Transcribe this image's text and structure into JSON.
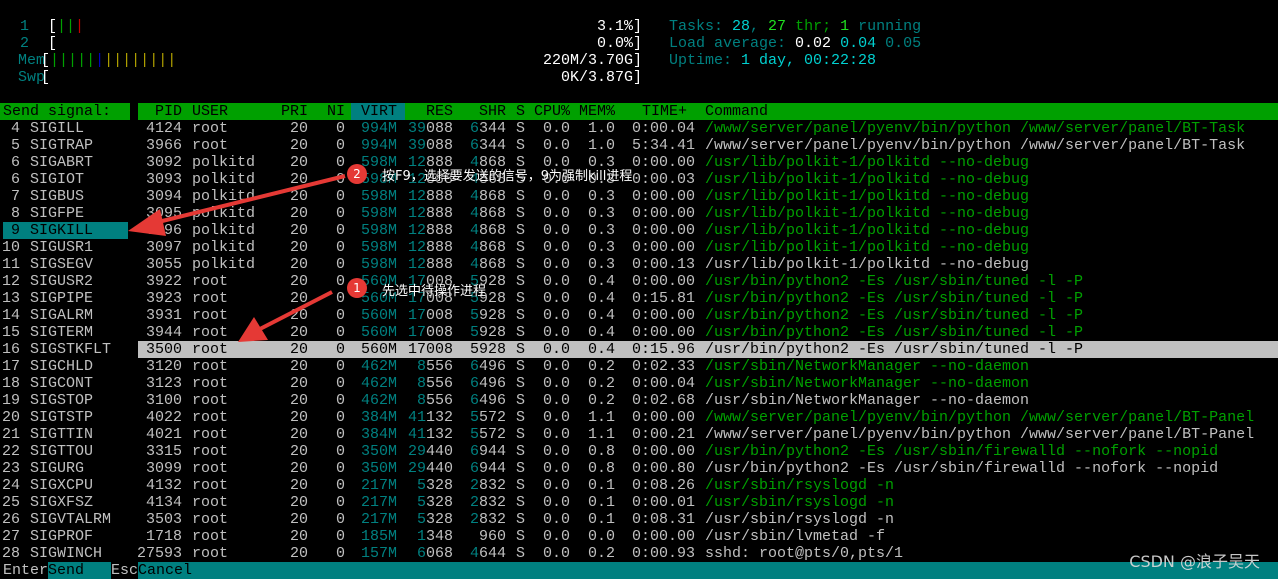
{
  "meters": {
    "cpu1": {
      "label": "1",
      "bars": [
        {
          "c": "#00a000"
        },
        {
          "c": "#00a000"
        },
        {
          "c": "#c00000"
        }
      ],
      "value": "3.1%"
    },
    "cpu2": {
      "label": "2",
      "bars": [],
      "value": "0.0%"
    },
    "mem": {
      "label": "Mem",
      "bars": [
        {
          "c": "#00a000"
        },
        {
          "c": "#00a000"
        },
        {
          "c": "#00a000"
        },
        {
          "c": "#00a000"
        },
        {
          "c": "#00a000"
        },
        {
          "c": "#0000c0"
        },
        {
          "c": "#b0a000"
        },
        {
          "c": "#b0a000"
        },
        {
          "c": "#b0a000"
        },
        {
          "c": "#b0a000"
        },
        {
          "c": "#b0a000"
        },
        {
          "c": "#b0a000"
        },
        {
          "c": "#b0a000"
        },
        {
          "c": "#b0a000"
        }
      ],
      "value": "220M/3.70G"
    },
    "swp": {
      "label": "Swp",
      "bars": [],
      "value": "0K/3.87G"
    }
  },
  "summary": {
    "tasks_label": "Tasks: ",
    "tasks": "28",
    "sep1": ", ",
    "threads": "27",
    "thr_label": " thr; ",
    "running": "1",
    "running_label": " running",
    "load_label": "Load average: ",
    "load1": "0.02",
    "load5": "0.04",
    "load15": "0.05",
    "uptime_label": "Uptime: ",
    "uptime": "1 day, 00:22:28"
  },
  "signal_panel": {
    "title": "Send signal:",
    "selected": "SIGKILL"
  },
  "columns": [
    "PID",
    "USER",
    "PRI",
    "NI",
    "VIRT",
    "RES",
    "SHR",
    "S",
    "CPU%",
    "MEM%",
    "TIME+",
    "Command"
  ],
  "sorted_column": "VIRT",
  "rows": [
    {
      "sn": "4",
      "sig": "SIGILL",
      "pid": "4124",
      "user": "root",
      "pri": "20",
      "ni": "0",
      "virt": "994M",
      "res": "39088",
      "shr": "6344",
      "s": "S",
      "cpu": "0.0",
      "mem": "1.0",
      "time": "0:00.04",
      "cmd": "/www/server/panel/pyenv/bin/python /www/server/panel/BT-Task",
      "thread": true
    },
    {
      "sn": "5",
      "sig": "SIGTRAP",
      "pid": "3966",
      "user": "root",
      "pri": "20",
      "ni": "0",
      "virt": "994M",
      "res": "39088",
      "shr": "6344",
      "s": "S",
      "cpu": "0.0",
      "mem": "1.0",
      "time": "5:34.41",
      "cmd": "/www/server/panel/pyenv/bin/python /www/server/panel/BT-Task",
      "thread": false
    },
    {
      "sn": "6",
      "sig": "SIGABRT",
      "pid": "3092",
      "user": "polkitd",
      "pri": "20",
      "ni": "0",
      "virt": "598M",
      "res": "12888",
      "shr": "4868",
      "s": "S",
      "cpu": "0.0",
      "mem": "0.3",
      "time": "0:00.00",
      "cmd": "/usr/lib/polkit-1/polkitd --no-debug",
      "thread": true
    },
    {
      "sn": "6",
      "sig": "SIGIOT",
      "pid": "3093",
      "user": "polkitd",
      "pri": "20",
      "ni": "0",
      "virt": "598M",
      "res": "12888",
      "shr": "4868",
      "s": "S",
      "cpu": "0.0",
      "mem": "0.3",
      "time": "0:00.03",
      "cmd": "/usr/lib/polkit-1/polkitd --no-debug",
      "thread": true
    },
    {
      "sn": "7",
      "sig": "SIGBUS",
      "pid": "3094",
      "user": "polkitd",
      "pri": "20",
      "ni": "0",
      "virt": "598M",
      "res": "12888",
      "shr": "4868",
      "s": "S",
      "cpu": "0.0",
      "mem": "0.3",
      "time": "0:00.00",
      "cmd": "/usr/lib/polkit-1/polkitd --no-debug",
      "thread": true
    },
    {
      "sn": "8",
      "sig": "SIGFPE",
      "pid": "3095",
      "user": "polkitd",
      "pri": "20",
      "ni": "0",
      "virt": "598M",
      "res": "12888",
      "shr": "4868",
      "s": "S",
      "cpu": "0.0",
      "mem": "0.3",
      "time": "0:00.00",
      "cmd": "/usr/lib/polkit-1/polkitd --no-debug",
      "thread": true
    },
    {
      "sn": "9",
      "sig": "SIGKILL",
      "pid": "3096",
      "user": "polkitd",
      "pri": "20",
      "ni": "0",
      "virt": "598M",
      "res": "12888",
      "shr": "4868",
      "s": "S",
      "cpu": "0.0",
      "mem": "0.3",
      "time": "0:00.00",
      "cmd": "/usr/lib/polkit-1/polkitd --no-debug",
      "thread": true
    },
    {
      "sn": "10",
      "sig": "SIGUSR1",
      "pid": "3097",
      "user": "polkitd",
      "pri": "20",
      "ni": "0",
      "virt": "598M",
      "res": "12888",
      "shr": "4868",
      "s": "S",
      "cpu": "0.0",
      "mem": "0.3",
      "time": "0:00.00",
      "cmd": "/usr/lib/polkit-1/polkitd --no-debug",
      "thread": true
    },
    {
      "sn": "11",
      "sig": "SIGSEGV",
      "pid": "3055",
      "user": "polkitd",
      "pri": "20",
      "ni": "0",
      "virt": "598M",
      "res": "12888",
      "shr": "4868",
      "s": "S",
      "cpu": "0.0",
      "mem": "0.3",
      "time": "0:00.13",
      "cmd": "/usr/lib/polkit-1/polkitd --no-debug",
      "thread": false
    },
    {
      "sn": "12",
      "sig": "SIGUSR2",
      "pid": "3922",
      "user": "root",
      "pri": "20",
      "ni": "0",
      "virt": "560M",
      "res": "17008",
      "shr": "5928",
      "s": "S",
      "cpu": "0.0",
      "mem": "0.4",
      "time": "0:00.00",
      "cmd": "/usr/bin/python2 -Es /usr/sbin/tuned -l -P",
      "thread": true
    },
    {
      "sn": "13",
      "sig": "SIGPIPE",
      "pid": "3923",
      "user": "root",
      "pri": "20",
      "ni": "0",
      "virt": "560M",
      "res": "17008",
      "shr": "5928",
      "s": "S",
      "cpu": "0.0",
      "mem": "0.4",
      "time": "0:15.81",
      "cmd": "/usr/bin/python2 -Es /usr/sbin/tuned -l -P",
      "thread": true
    },
    {
      "sn": "14",
      "sig": "SIGALRM",
      "pid": "3931",
      "user": "root",
      "pri": "20",
      "ni": "0",
      "virt": "560M",
      "res": "17008",
      "shr": "5928",
      "s": "S",
      "cpu": "0.0",
      "mem": "0.4",
      "time": "0:00.00",
      "cmd": "/usr/bin/python2 -Es /usr/sbin/tuned -l -P",
      "thread": true
    },
    {
      "sn": "15",
      "sig": "SIGTERM",
      "pid": "3944",
      "user": "root",
      "pri": "20",
      "ni": "0",
      "virt": "560M",
      "res": "17008",
      "shr": "5928",
      "s": "S",
      "cpu": "0.0",
      "mem": "0.4",
      "time": "0:00.00",
      "cmd": "/usr/bin/python2 -Es /usr/sbin/tuned -l -P",
      "thread": true
    },
    {
      "sn": "16",
      "sig": "SIGSTKFLT",
      "pid": "3500",
      "user": "root",
      "pri": "20",
      "ni": "0",
      "virt": "560M",
      "res": "17008",
      "shr": "5928",
      "s": "S",
      "cpu": "0.0",
      "mem": "0.4",
      "time": "0:15.96",
      "cmd": "/usr/bin/python2 -Es /usr/sbin/tuned -l -P",
      "thread": false,
      "selected": true
    },
    {
      "sn": "17",
      "sig": "SIGCHLD",
      "pid": "3120",
      "user": "root",
      "pri": "20",
      "ni": "0",
      "virt": "462M",
      "res": "8556",
      "shr": "6496",
      "s": "S",
      "cpu": "0.0",
      "mem": "0.2",
      "time": "0:02.33",
      "cmd": "/usr/sbin/NetworkManager --no-daemon",
      "thread": true
    },
    {
      "sn": "18",
      "sig": "SIGCONT",
      "pid": "3123",
      "user": "root",
      "pri": "20",
      "ni": "0",
      "virt": "462M",
      "res": "8556",
      "shr": "6496",
      "s": "S",
      "cpu": "0.0",
      "mem": "0.2",
      "time": "0:00.04",
      "cmd": "/usr/sbin/NetworkManager --no-daemon",
      "thread": true
    },
    {
      "sn": "19",
      "sig": "SIGSTOP",
      "pid": "3100",
      "user": "root",
      "pri": "20",
      "ni": "0",
      "virt": "462M",
      "res": "8556",
      "shr": "6496",
      "s": "S",
      "cpu": "0.0",
      "mem": "0.2",
      "time": "0:02.68",
      "cmd": "/usr/sbin/NetworkManager --no-daemon",
      "thread": false
    },
    {
      "sn": "20",
      "sig": "SIGTSTP",
      "pid": "4022",
      "user": "root",
      "pri": "20",
      "ni": "0",
      "virt": "384M",
      "res": "41132",
      "shr": "5572",
      "s": "S",
      "cpu": "0.0",
      "mem": "1.1",
      "time": "0:00.00",
      "cmd": "/www/server/panel/pyenv/bin/python /www/server/panel/BT-Panel",
      "thread": true
    },
    {
      "sn": "21",
      "sig": "SIGTTIN",
      "pid": "4021",
      "user": "root",
      "pri": "20",
      "ni": "0",
      "virt": "384M",
      "res": "41132",
      "shr": "5572",
      "s": "S",
      "cpu": "0.0",
      "mem": "1.1",
      "time": "0:00.21",
      "cmd": "/www/server/panel/pyenv/bin/python /www/server/panel/BT-Panel",
      "thread": false
    },
    {
      "sn": "22",
      "sig": "SIGTTOU",
      "pid": "3315",
      "user": "root",
      "pri": "20",
      "ni": "0",
      "virt": "350M",
      "res": "29440",
      "shr": "6944",
      "s": "S",
      "cpu": "0.0",
      "mem": "0.8",
      "time": "0:00.00",
      "cmd": "/usr/bin/python2 -Es /usr/sbin/firewalld --nofork --nopid",
      "thread": true
    },
    {
      "sn": "23",
      "sig": "SIGURG",
      "pid": "3099",
      "user": "root",
      "pri": "20",
      "ni": "0",
      "virt": "350M",
      "res": "29440",
      "shr": "6944",
      "s": "S",
      "cpu": "0.0",
      "mem": "0.8",
      "time": "0:00.80",
      "cmd": "/usr/bin/python2 -Es /usr/sbin/firewalld --nofork --nopid",
      "thread": false
    },
    {
      "sn": "24",
      "sig": "SIGXCPU",
      "pid": "4132",
      "user": "root",
      "pri": "20",
      "ni": "0",
      "virt": "217M",
      "res": "5328",
      "shr": "2832",
      "s": "S",
      "cpu": "0.0",
      "mem": "0.1",
      "time": "0:08.26",
      "cmd": "/usr/sbin/rsyslogd -n",
      "thread": true
    },
    {
      "sn": "25",
      "sig": "SIGXFSZ",
      "pid": "4134",
      "user": "root",
      "pri": "20",
      "ni": "0",
      "virt": "217M",
      "res": "5328",
      "shr": "2832",
      "s": "S",
      "cpu": "0.0",
      "mem": "0.1",
      "time": "0:00.01",
      "cmd": "/usr/sbin/rsyslogd -n",
      "thread": true
    },
    {
      "sn": "26",
      "sig": "SIGVTALRM",
      "pid": "3503",
      "user": "root",
      "pri": "20",
      "ni": "0",
      "virt": "217M",
      "res": "5328",
      "shr": "2832",
      "s": "S",
      "cpu": "0.0",
      "mem": "0.1",
      "time": "0:08.31",
      "cmd": "/usr/sbin/rsyslogd -n",
      "thread": false
    },
    {
      "sn": "27",
      "sig": "SIGPROF",
      "pid": "1718",
      "user": "root",
      "pri": "20",
      "ni": "0",
      "virt": "185M",
      "res": "1348",
      "shr": "960",
      "s": "S",
      "cpu": "0.0",
      "mem": "0.0",
      "time": "0:00.00",
      "cmd": "/usr/sbin/lvmetad -f",
      "thread": false
    },
    {
      "sn": "28",
      "sig": "SIGWINCH",
      "pid": "27593",
      "user": "root",
      "pri": "20",
      "ni": "0",
      "virt": "157M",
      "res": "6068",
      "shr": "4644",
      "s": "S",
      "cpu": "0.0",
      "mem": "0.2",
      "time": "0:00.93",
      "cmd": "sshd: root@pts/0,pts/1",
      "thread": false
    }
  ],
  "footer": {
    "key1": "Enter",
    "label1": "Send",
    "key2": "Esc",
    "label2": "Cancel"
  },
  "annotations": {
    "step2_num": "2",
    "step2_text": "按F9，选择要发送的信号，9为强制kill进程",
    "step1_num": "1",
    "step1_text": "先选中待操作进程",
    "color": "#e53935"
  },
  "watermark": "CSDN @浪子吴天"
}
